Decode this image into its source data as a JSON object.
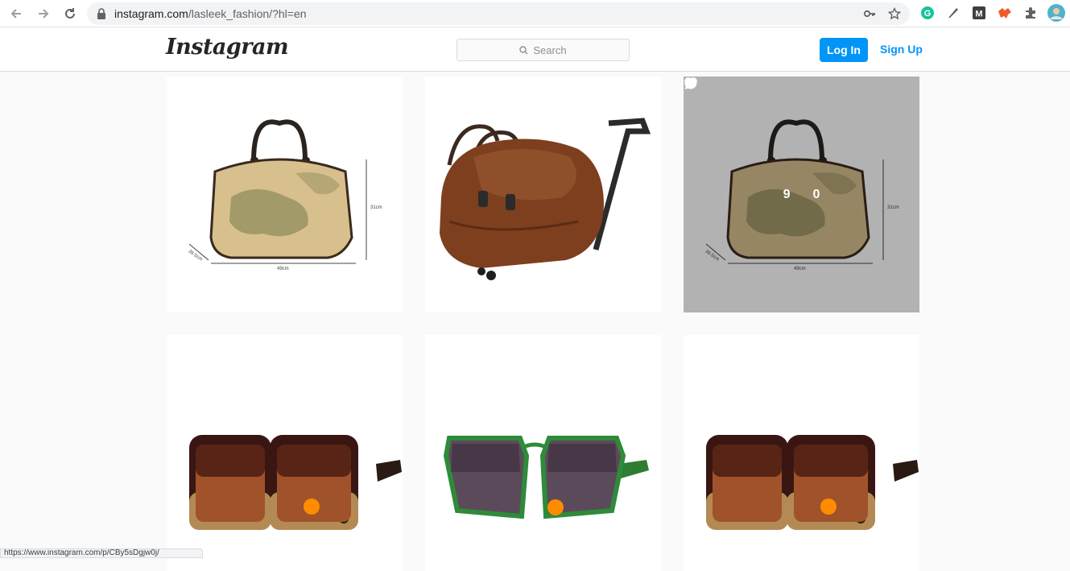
{
  "browser": {
    "url_host": "instagram.com",
    "url_path": "/lasleek_fashion/?hl=en",
    "status_url": "https://www.instagram.com/p/CBy5sDgjw0j/"
  },
  "header": {
    "logo_text": "Instagram",
    "search_placeholder": "Search",
    "login_label": "Log In",
    "signup_label": "Sign Up"
  },
  "posts": [
    {
      "item": "map-print-duffel-bag",
      "dims": [
        "31cm",
        "49cm",
        "26.5cm"
      ]
    },
    {
      "item": "brown-trolley-bag"
    },
    {
      "item": "map-print-duffel-bag",
      "dims": [
        "31cm",
        "49cm",
        "26.5cm"
      ],
      "hovered": true,
      "likes": "9",
      "comments": "0"
    },
    {
      "item": "tortoise-sunglasses"
    },
    {
      "item": "green-sunglasses"
    },
    {
      "item": "tortoise-sunglasses"
    }
  ],
  "colors": {
    "accent": "#0095f6",
    "page_bg": "#fafafa",
    "border": "#dbdbdb"
  }
}
